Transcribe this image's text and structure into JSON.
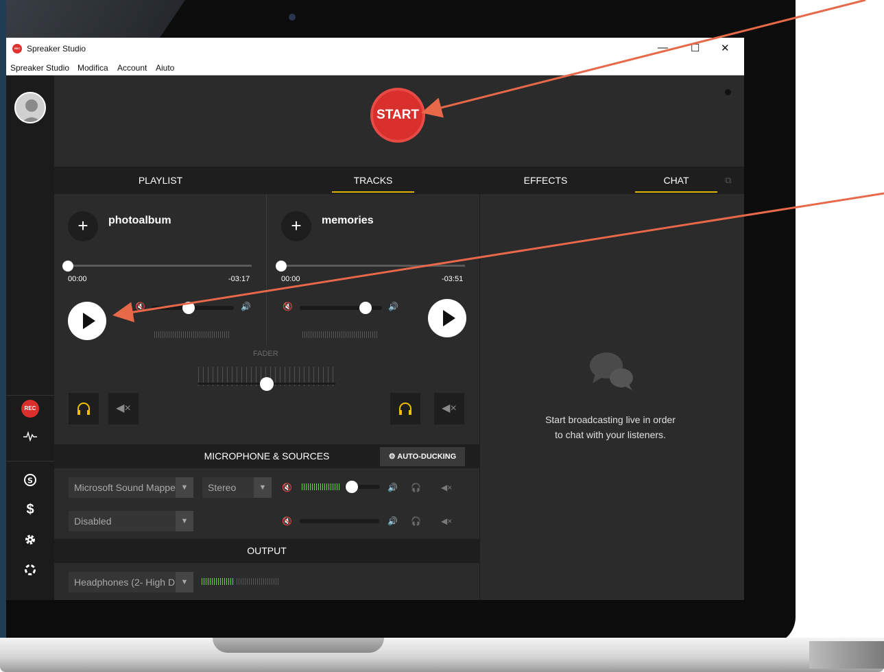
{
  "window": {
    "title": "Spreaker Studio",
    "app_icon_text": "REC",
    "controls": {
      "minimize": "—",
      "maximize": "☐",
      "close": "✕"
    }
  },
  "menu": [
    "Spreaker Studio",
    "Modifica",
    "Account",
    "Aiuto"
  ],
  "start_button": "START",
  "tabs": [
    "PLAYLIST",
    "TRACKS",
    "EFFECTS",
    "CHAT"
  ],
  "active_tabs": [
    "TRACKS",
    "CHAT"
  ],
  "decks": [
    {
      "title": "photoalbum",
      "elapsed": "00:00",
      "remaining": "-03:17",
      "progress": 0,
      "volume": 0.45
    },
    {
      "title": "memories",
      "elapsed": "00:00",
      "remaining": "-03:51",
      "progress": 0,
      "volume": 0.8
    }
  ],
  "fader": {
    "label": "FADER",
    "position": 0.5
  },
  "mic_section": {
    "title": "MICROPHONE & SOURCES",
    "auto_ducking": "AUTO-DUCKING",
    "source1": {
      "device": "Microsoft Sound Mappe",
      "mode": "Stereo",
      "volume": 0.5
    },
    "source2": {
      "device": "Disabled"
    }
  },
  "output_section": {
    "title": "OUTPUT",
    "device": "Headphones (2- High D"
  },
  "sidebar": {
    "rec_label": "REC",
    "icons": [
      "avatar",
      "rec-icon",
      "pulse-icon",
      "skype-icon",
      "dollar-icon",
      "gear-icon",
      "help-icon"
    ]
  },
  "chat": {
    "line1": "Start broadcasting live in order",
    "line2": "to chat with your listeners."
  },
  "colors": {
    "accent": "#e0b400",
    "start_red": "#d9302d",
    "meter_green": "#6ad24a",
    "arrow": "#e8684a"
  }
}
